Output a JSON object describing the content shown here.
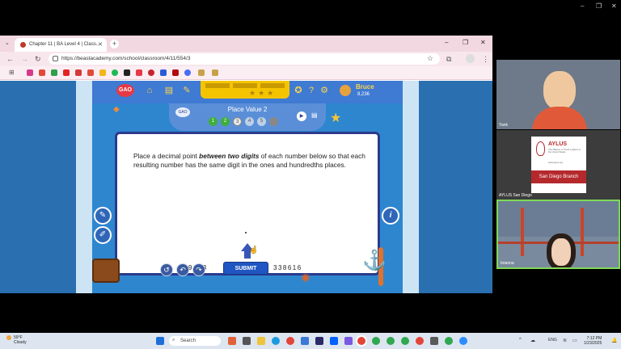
{
  "screen_controls": {
    "minimize": "–",
    "restore": "❐",
    "close": "✕"
  },
  "browser": {
    "tab_title": "Chapter 11 | BA Level 4 | Class...",
    "url": "https://beastacademy.com/school/classroom/4/11/554/3",
    "new_tab": "+"
  },
  "game": {
    "logo": "GAO",
    "user_name": "Bruce",
    "coins": "8,236",
    "lesson_title": "Place Value 2",
    "steps": [
      "1",
      "2",
      "3",
      "4",
      "5"
    ],
    "prompt_pre": "Place a decimal point ",
    "prompt_emph": "between two digits",
    "prompt_post": " of each number below so that each resulting number has the same digit in the ones and hundredths places.",
    "numbers": [
      "69623",
      "45254",
      "338616"
    ],
    "submit_label": "SUBMIT",
    "info_label": "i",
    "lesson_logo": "GAO"
  },
  "video_tiles": [
    {
      "name": "Yank"
    },
    {
      "name": "AYLUS San Diego",
      "logo_title": "AYLUS",
      "logo_sub": "The Alliance of Youth Leaders in the United States",
      "logo_url": "www.aylus.org",
      "branch": "San Diego Branch"
    },
    {
      "name": "brianna"
    }
  ],
  "taskbar": {
    "temp": "59°F",
    "condition": "Cloudy",
    "search_placeholder": "Search",
    "lang": "ENG",
    "time": "7:12 PM",
    "date": "1/23/2025"
  },
  "colors": {
    "game_blue": "#2e86cf",
    "card_border": "#2b3a8c",
    "submit": "#1f56c2",
    "progress_yellow": "#f5c400"
  }
}
